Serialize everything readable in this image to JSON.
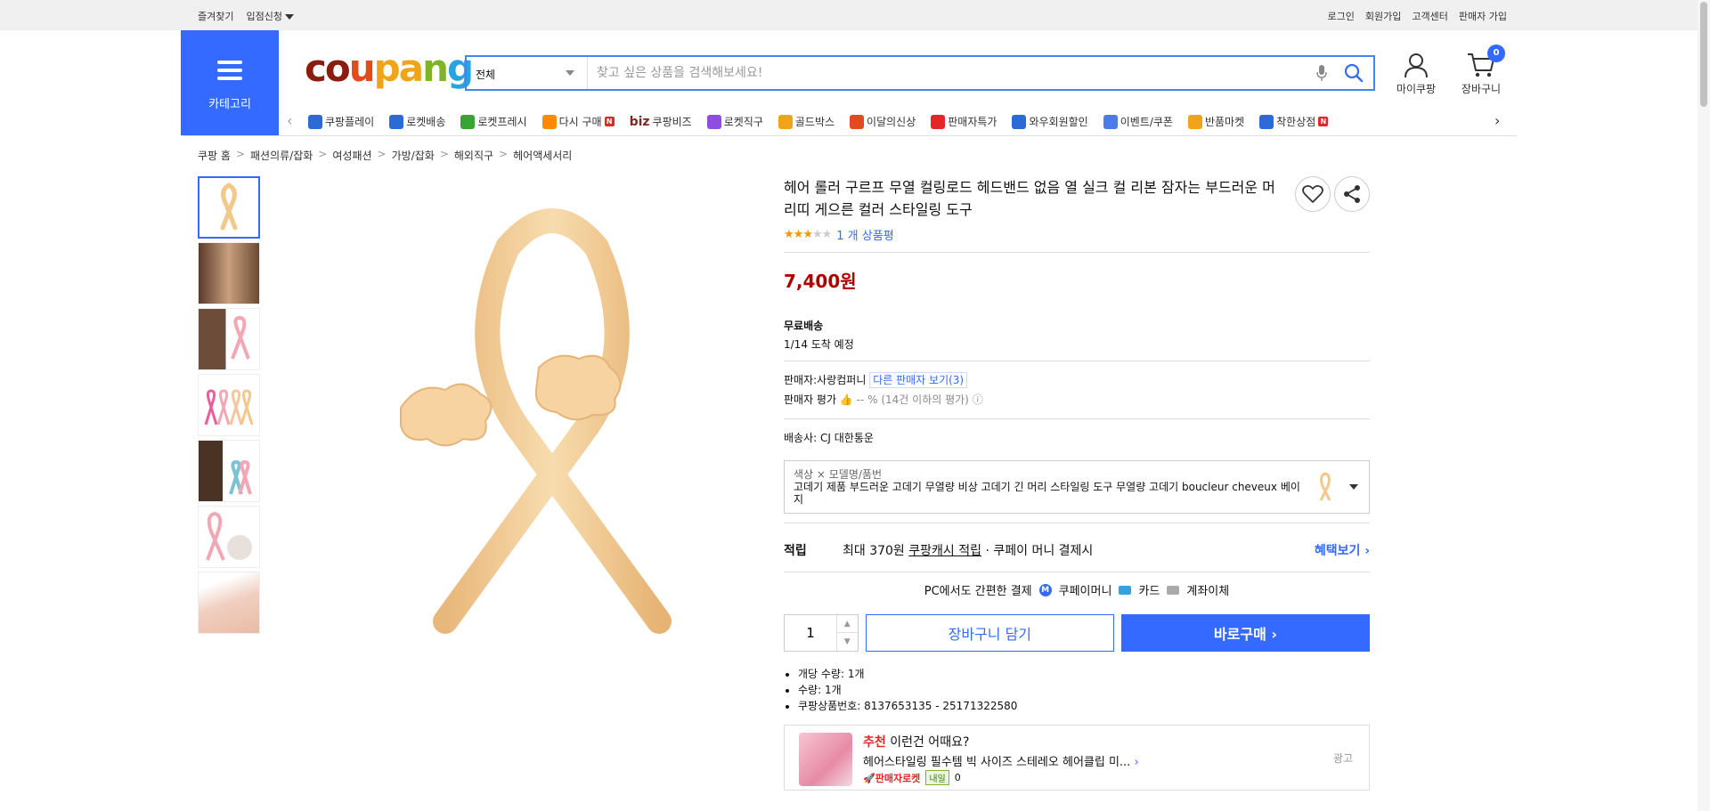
{
  "topbar": {
    "left": [
      "즐겨찾기",
      "입점신청"
    ],
    "right": [
      "로그인",
      "회원가입",
      "고객센터",
      "판매자 가입"
    ]
  },
  "header": {
    "category_label": "카테고리",
    "logo": [
      "co",
      "u",
      "pa",
      "n",
      "g"
    ],
    "search_select": "전체",
    "search_placeholder": "찾고 싶은 상품을 검색해보세요!",
    "mycoupang_label": "마이쿠팡",
    "cart_label": "장바구니",
    "cart_count": "0"
  },
  "quicknav": [
    {
      "label": "쿠팡플레이",
      "color": "#2c6bd6"
    },
    {
      "label": "로켓배송",
      "color": "#2c6bd6"
    },
    {
      "label": "로켓프레시",
      "color": "#3aa335"
    },
    {
      "label": "다시 구매",
      "color": "#ff8a00",
      "badge": "N"
    },
    {
      "label": "쿠팡비즈",
      "color": "#7a2b22",
      "prefix": "biz"
    },
    {
      "label": "로켓직구",
      "color": "#8c4de0"
    },
    {
      "label": "골드박스",
      "color": "#f0a419"
    },
    {
      "label": "이달의신상",
      "color": "#e24b1c"
    },
    {
      "label": "판매자특가",
      "color": "#e52528"
    },
    {
      "label": "와우회원할인",
      "color": "#2c6bd6"
    },
    {
      "label": "이벤트/쿠폰",
      "color": "#4a7be8"
    },
    {
      "label": "반품마켓",
      "color": "#f0a419"
    },
    {
      "label": "착한상점",
      "color": "#2c6bd6",
      "badge": "N"
    }
  ],
  "breadcrumb": [
    "쿠팡 홈",
    "패션의류/잡화",
    "여성패션",
    "가방/잡화",
    "해외직구",
    "헤어액세서리"
  ],
  "product": {
    "title": "헤어 롤러 구르프 무열 컬링로드 헤드밴드 없음 열 실크 컬 리본 잠자는 부드러운 머리띠 게으른 컬러 스타일링 도구",
    "rating": 3,
    "review_text": "1 개 상품평",
    "price": "7,400원",
    "shipping_title": "무료배송",
    "arrival": "1/14 도착 예정",
    "seller_label": "판매자:",
    "seller_name": "사랑컴퍼니",
    "other_sellers": "다른 판매자 보기(3)",
    "seller_rating_label": "판매자 평가",
    "seller_rating_value": "-- %",
    "seller_rating_note": "(14건 이하의 평가)",
    "carrier_label": "배송사:",
    "carrier": "CJ 대한통운",
    "option_label": "색상 × 모델명/품번",
    "option_value": "고데기 제품 부드러운 고데기 무열량 비상 고데기 긴 머리 스타일링 도구 무열량 고데기 boucleur cheveux 베이지",
    "reward_head": "적립",
    "reward_text1": "최대 370원",
    "reward_link": "쿠팡캐시 적립",
    "reward_text2": "· 쿠페이 머니 결제시",
    "reward_more": "혜택보기",
    "pay_title": "PC에서도 간편한 결제",
    "pay_methods": [
      "쿠페이머니",
      "카드",
      "계좌이체"
    ],
    "qty": "1",
    "btn_cart": "장바구니 담기",
    "btn_buy": "바로구매",
    "specs": [
      "개당 수량: 1개",
      "수량: 1개",
      "쿠팡상품번호: 8137653135 - 25171322580"
    ]
  },
  "recommend": {
    "head_red": "추천",
    "head": "이런건 어때요?",
    "title": "헤어스타일링 필수템 빅 사이즈 스테레오 헤어클립 미...",
    "rocket": "판매자로켓",
    "tomorrow": "내일",
    "count": "0",
    "ad": "광고"
  }
}
